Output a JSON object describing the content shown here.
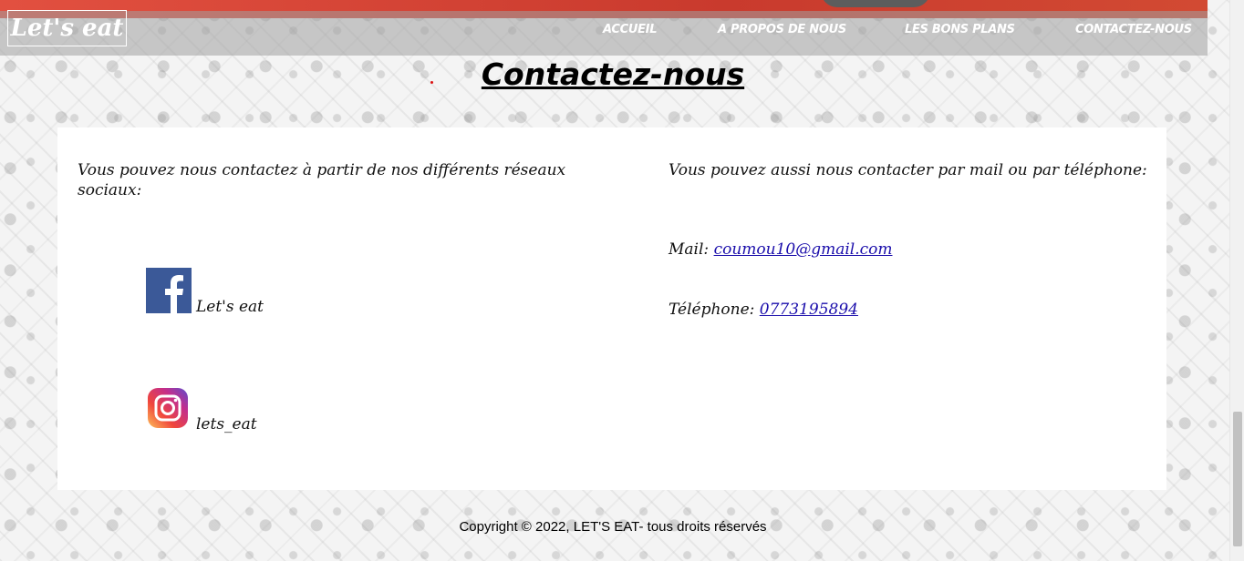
{
  "brand": {
    "logo_text": "Let's eat"
  },
  "nav": {
    "items": [
      {
        "label": "ACCUEIL"
      },
      {
        "label": "A PROPOS DE NOUS"
      },
      {
        "label": "LES BONS PLANS"
      },
      {
        "label": "CONTACTEZ-NOUS"
      }
    ]
  },
  "main": {
    "title": "Contactez-nous",
    "social": {
      "intro": "Vous pouvez nous contactez à partir de nos différents réseaux sociaux:",
      "facebook": {
        "icon": "facebook-icon",
        "label": "Let's eat"
      },
      "instagram": {
        "icon": "instagram-icon",
        "label": "lets_eat"
      }
    },
    "contact": {
      "intro": "Vous pouvez aussi nous contacter par mail ou par téléphone:",
      "mail_label": "Mail:",
      "mail_value": "coumou10@gmail.com",
      "phone_label": "Téléphone:",
      "phone_value": "0773195894"
    }
  },
  "footer": {
    "copyright": "Copyright © 2022, LET'S EAT- tous droits réservés"
  },
  "colors": {
    "facebook": "#3b5998",
    "link": "#1a0dab",
    "brand_red": "#c93a2d"
  }
}
